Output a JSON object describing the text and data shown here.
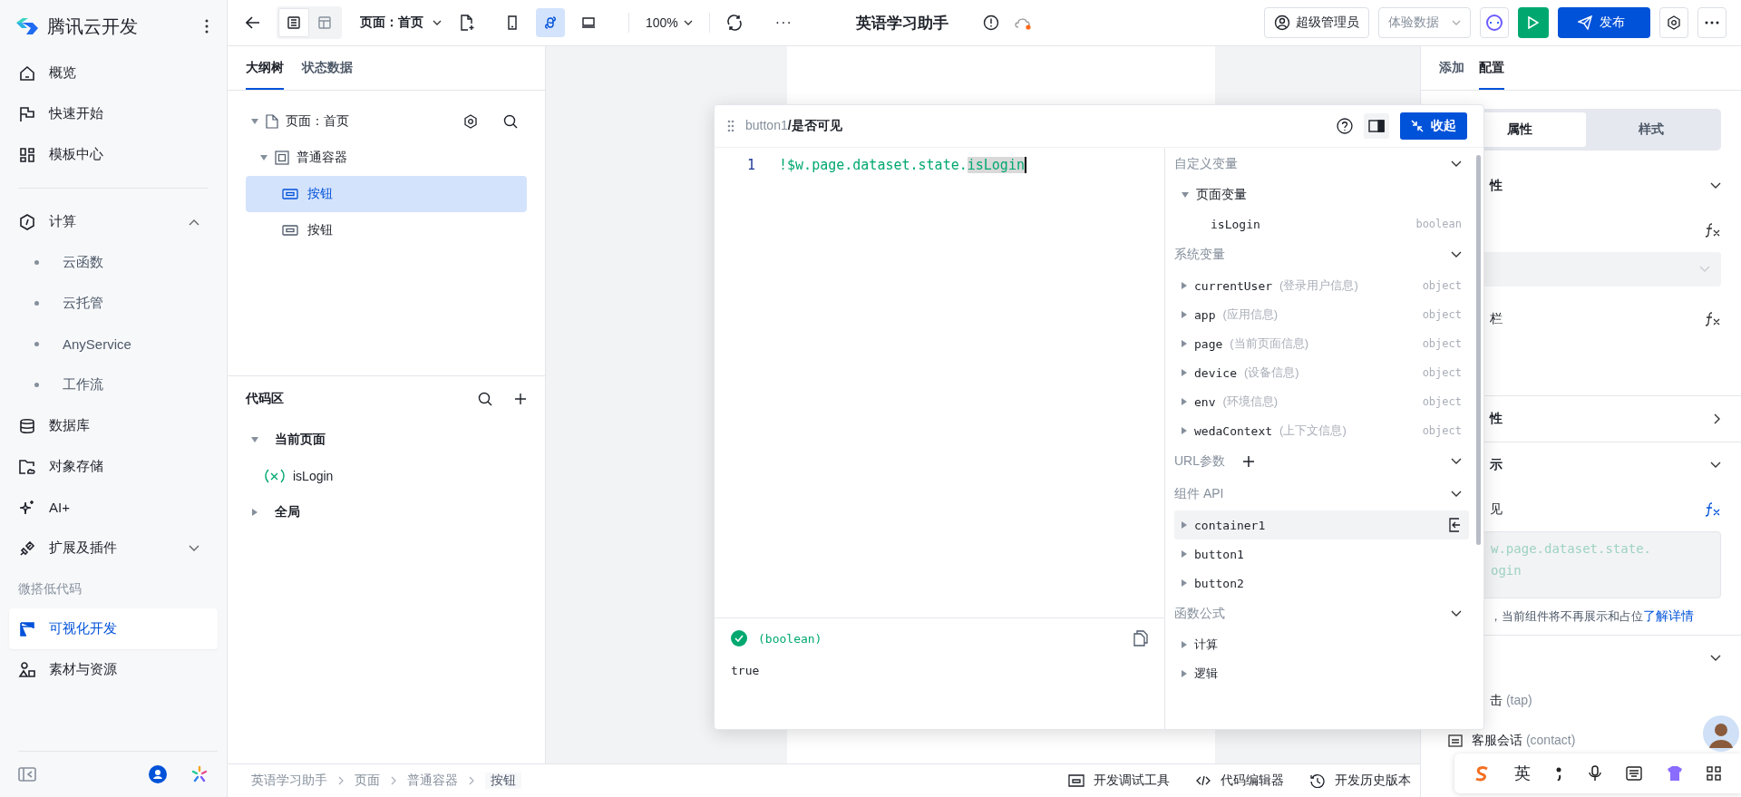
{
  "sidebar": {
    "brand": "腾讯云开发",
    "items": [
      {
        "kind": "nav",
        "label": "概览",
        "selected": false
      },
      {
        "kind": "nav",
        "label": "快速开始",
        "selected": false
      },
      {
        "kind": "nav",
        "label": "模板中心",
        "selected": false
      },
      {
        "kind": "divider"
      },
      {
        "kind": "group",
        "label": "计算",
        "expanded": true,
        "children": [
          {
            "label": "云函数"
          },
          {
            "label": "云托管"
          },
          {
            "label": "AnyService"
          },
          {
            "label": "工作流"
          }
        ]
      },
      {
        "kind": "nav",
        "label": "数据库",
        "selected": false
      },
      {
        "kind": "nav",
        "label": "对象存储",
        "selected": false
      },
      {
        "kind": "nav",
        "label": "AI+",
        "selected": false
      },
      {
        "kind": "group",
        "label": "扩展及插件",
        "expanded": false
      },
      {
        "kind": "heading",
        "label": "微搭低代码"
      },
      {
        "kind": "nav",
        "label": "可视化开发",
        "selected": true
      },
      {
        "kind": "nav",
        "label": "素材与资源",
        "selected": false
      }
    ]
  },
  "toolbar": {
    "views": [
      {
        "selected": true
      },
      {
        "selected": false
      }
    ],
    "page_select": "页面：首页",
    "devices": [
      {
        "selected": false
      },
      {
        "selected": true
      },
      {
        "selected": false
      }
    ],
    "zoom": "100%",
    "more": "···",
    "app_title": "英语学习助手",
    "role_button": "超级管理员",
    "data_select": "体验数据",
    "publish_button": "发布"
  },
  "outline": {
    "tabs": [
      {
        "label": "大纲树",
        "selected": true
      },
      {
        "label": "状态数据",
        "selected": false
      }
    ],
    "tree": [
      {
        "label": "页面：首页",
        "expanded": true,
        "selected": false,
        "children": [
          {
            "label": "普通容器",
            "expanded": true,
            "selected": false,
            "children": [
              {
                "label": "按钮",
                "selected": true
              },
              {
                "label": "按钮",
                "selected": false
              }
            ]
          }
        ]
      }
    ],
    "code_title": "代码区",
    "code_groups": [
      {
        "label": "当前页面",
        "expanded": true,
        "children": [
          {
            "label": "isLogin"
          }
        ]
      },
      {
        "label": "全局",
        "expanded": false
      }
    ]
  },
  "expression_editor": {
    "path": "button1",
    "field": "/是否可见",
    "collapse_button": "收起",
    "line_number": "1",
    "code": "!$w.page.dataset.state.",
    "selected_code": "isLogin",
    "result_type": "(boolean)",
    "result_value": "true",
    "sections": [
      {
        "title": "自定义变量",
        "expanded": true,
        "items": [
          {
            "kind": "folder",
            "name": "页面变量",
            "expanded": true,
            "selected": false
          },
          {
            "kind": "leaf",
            "name": "isLogin",
            "type": "boolean",
            "selected": false
          }
        ]
      },
      {
        "title": "系统变量",
        "expanded": true,
        "items": [
          {
            "kind": "node",
            "name": "currentUser",
            "note": "(登录用户信息)",
            "type": "object",
            "selected": false
          },
          {
            "kind": "node",
            "name": "app",
            "note": "(应用信息)",
            "type": "object",
            "selected": false
          },
          {
            "kind": "node",
            "name": "page",
            "note": "(当前页面信息)",
            "type": "object",
            "selected": false
          },
          {
            "kind": "node",
            "name": "device",
            "note": "(设备信息)",
            "type": "object",
            "selected": false
          },
          {
            "kind": "node",
            "name": "env",
            "note": "(环境信息)",
            "type": "object",
            "selected": false
          },
          {
            "kind": "node",
            "name": "wedaContext",
            "note": "(上下文信息)",
            "type": "object",
            "selected": false
          }
        ]
      },
      {
        "title": "URL参数",
        "expanded": true,
        "can_add": true
      },
      {
        "title": "组件 API",
        "expanded": true,
        "items": [
          {
            "kind": "node",
            "name": "container1",
            "selected": true
          },
          {
            "kind": "node",
            "name": "button1",
            "selected": false
          },
          {
            "kind": "node",
            "name": "button2",
            "selected": false
          }
        ]
      },
      {
        "title": "函数公式",
        "expanded": true,
        "items": [
          {
            "kind": "node",
            "name": "计算",
            "selected": false
          },
          {
            "kind": "node",
            "name": "逻辑",
            "selected": false
          }
        ]
      }
    ]
  },
  "config_panel": {
    "tabs": [
      {
        "label": "添加",
        "selected": false
      },
      {
        "label": "配置",
        "selected": true
      }
    ],
    "segments": [
      {
        "label": "属性",
        "selected": true
      },
      {
        "label": "样式",
        "selected": false
      }
    ],
    "section_1": "性",
    "row_1": "栏",
    "section_2": "性",
    "section_3": "示",
    "visible_label": "见",
    "visible_code_1": "w.page.dataset.state.",
    "visible_code_2": "ogin",
    "hint": "，当前组件将不再展示和占位",
    "hint_link": "了解详情",
    "event_1": "击",
    "event_1_note": "(tap)",
    "event_2": "客服会话",
    "event_2_note": "(contact)"
  },
  "status_bar": {
    "breadcrumb": [
      "英语学习助手",
      "页面",
      "普通容器",
      "按钮"
    ],
    "tools": [
      "开发调试工具",
      "代码编辑器",
      "开发历史版本"
    ]
  },
  "ime_bar": {
    "mode": "英"
  }
}
